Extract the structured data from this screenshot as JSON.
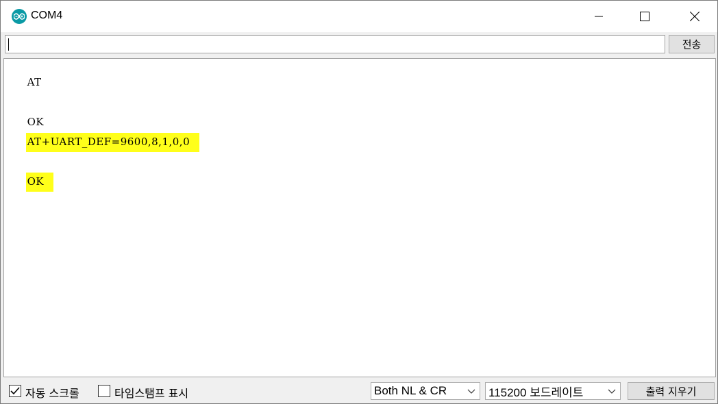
{
  "window": {
    "title": "COM4",
    "accent_color": "#0a9aa5"
  },
  "send_row": {
    "input_value": "",
    "send_label": "전송"
  },
  "output": {
    "lines": [
      {
        "text": "AT",
        "highlighted": false
      },
      {
        "text": "OK",
        "highlighted": false
      },
      {
        "text": "AT+UART_DEF=9600,8,1,0,0",
        "highlighted": true
      },
      {
        "text": "OK",
        "highlighted": true
      }
    ],
    "highlight_color": "#ffff1a"
  },
  "bottom_bar": {
    "autoscroll": {
      "label": "자동 스크롤",
      "checked": true
    },
    "timestamp": {
      "label": "타임스탬프 표시",
      "checked": false
    },
    "line_ending": {
      "selected": "Both NL & CR"
    },
    "baud_rate": {
      "selected": "115200 보드레이트"
    },
    "clear_label": "출력 지우기"
  }
}
